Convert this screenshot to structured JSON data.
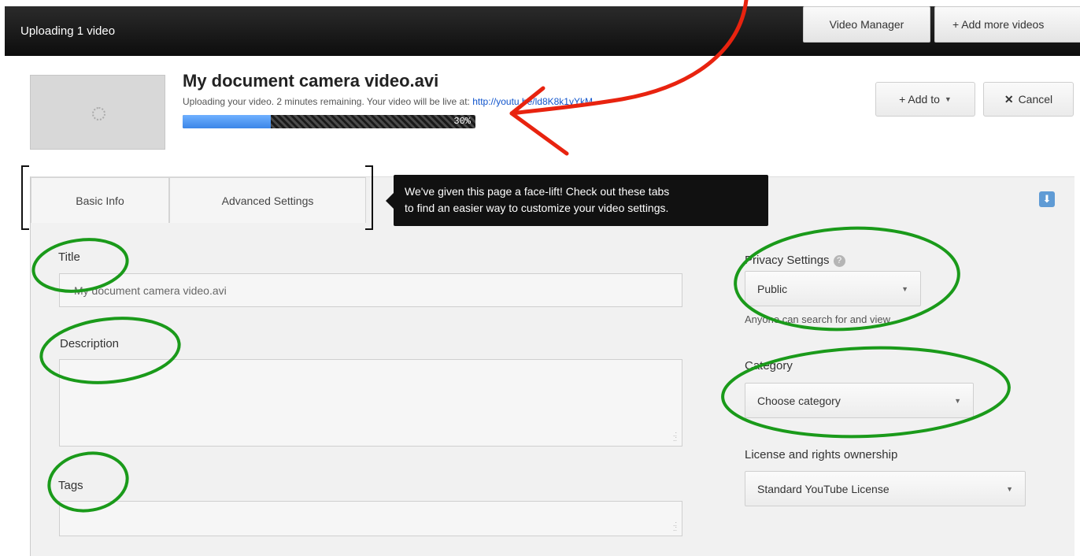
{
  "header": {
    "title": "Uploading 1 video",
    "video_manager_label": "Video Manager",
    "add_more_label": "+ Add more videos"
  },
  "upload": {
    "video_title": "My document camera video.avi",
    "status_text": "Uploading your video. 2 minutes remaining. Your video will be live at: ",
    "video_url": "http://youtu.be/ld8K8k1vYkM",
    "progress_label": "30%",
    "progress_percent": 30
  },
  "actions": {
    "add_to_label": "+ Add to",
    "cancel_label": "Cancel",
    "cancel_icon": "✕"
  },
  "tabs": [
    {
      "label": "Basic Info"
    },
    {
      "label": "Advanced Settings"
    }
  ],
  "tooltip": {
    "line1": "We've given this page a face-lift! Check out these tabs",
    "line2": "to find an easier way to customize your video settings."
  },
  "form": {
    "title_label": "Title",
    "title_value": "My document camera video.avi",
    "description_label": "Description",
    "description_value": "",
    "tags_label": "Tags",
    "tags_value": ""
  },
  "sidebar": {
    "privacy_label": "Privacy Settings",
    "privacy_value": "Public",
    "privacy_note": "Anyone can search for and view",
    "category_label": "Category",
    "category_value": "Choose category",
    "license_label": "License and rights ownership",
    "license_value": "Standard YouTube License"
  },
  "icons": {
    "help": "?",
    "download": "⬇",
    "caret": "▼"
  },
  "colors": {
    "progress_fill": "#3b86e8",
    "link": "#1155cc",
    "annotation_green": "#1a9a1a",
    "annotation_red": "#e8230f"
  }
}
